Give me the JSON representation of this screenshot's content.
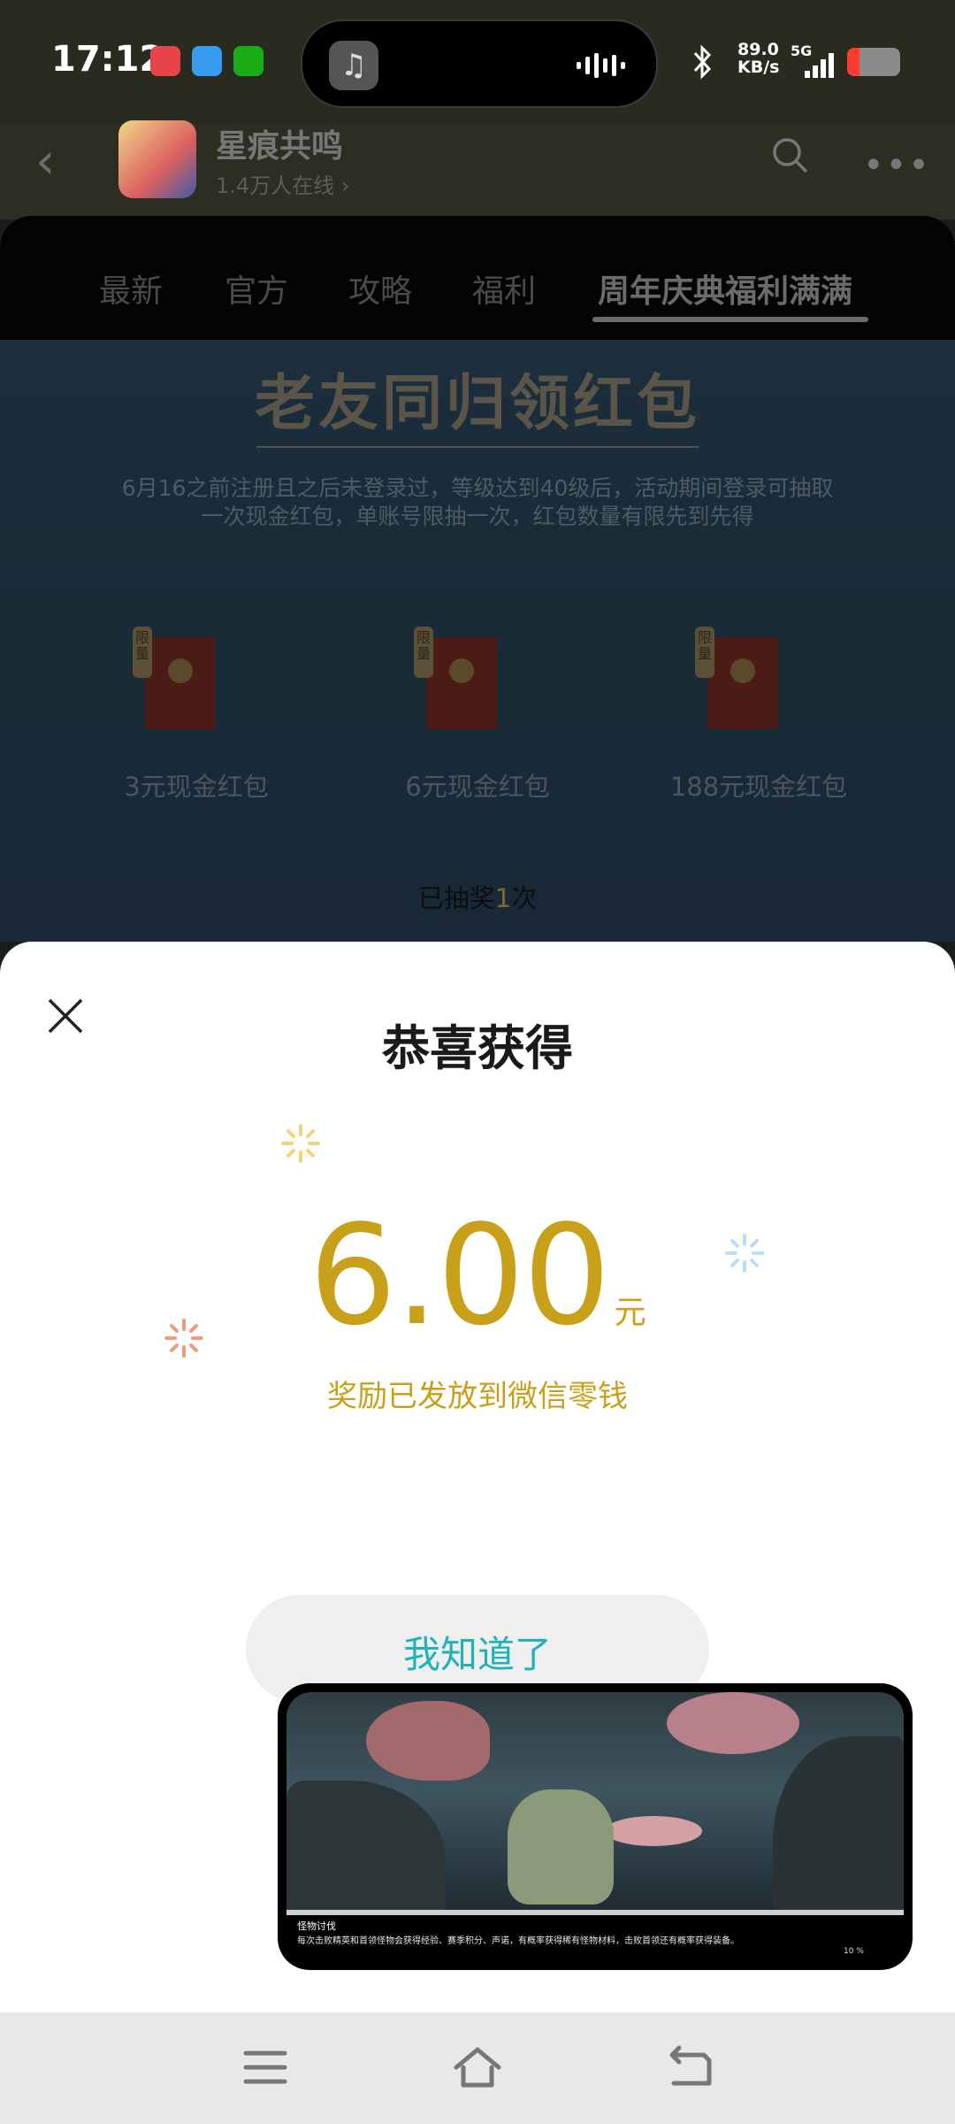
{
  "status_bar": {
    "time": "17:12",
    "net_speed_value": "89.0",
    "net_speed_unit": "KB/s",
    "network": "5G",
    "battery_level": 0.2
  },
  "header": {
    "back_icon": "chevron-left-icon",
    "community_title": "星痕共鸣",
    "online_count": "1.4万人在线",
    "search_icon": "search-icon",
    "more_icon": "more-icon"
  },
  "tabs": [
    {
      "label": "最新"
    },
    {
      "label": "官方"
    },
    {
      "label": "攻略"
    },
    {
      "label": "福利"
    },
    {
      "label": "周年庆典福利满满",
      "active": true
    }
  ],
  "event": {
    "title": "老友同归领红包",
    "description_line1": "6月16之前注册且之后未登录过，等级达到40级后，活动期间登录可抽取",
    "description_line2": "一次现金红包，单账号限抽一次，红包数量有限先到先得",
    "limited_tag": "限量",
    "packets": [
      {
        "label": "3元现金红包"
      },
      {
        "label": "6元现金红包"
      },
      {
        "label": "188元现金红包"
      }
    ],
    "drawn_prefix": "已抽奖",
    "drawn_count": "1",
    "drawn_suffix": "次"
  },
  "sheet": {
    "title": "恭喜获得",
    "amount": "6.00",
    "unit": "元",
    "reward_text": "奖励已发放到微信零钱",
    "confirm_label": "我知道了",
    "amount_color": "#c9a01a",
    "button_text_color": "#20b2b8"
  },
  "video_overlay": {
    "caption_title": "怪物讨伐",
    "caption_text": "每次击败精英和首领怪物会获得经验、赛季积分、声诺，有概率获得稀有怪物材料，击败首领还有概率获得装备。",
    "progress_label": "10 %"
  },
  "nav_bar": {
    "menu_icon": "menu-icon",
    "home_icon": "home-icon",
    "back_icon": "back-gesture-icon"
  }
}
